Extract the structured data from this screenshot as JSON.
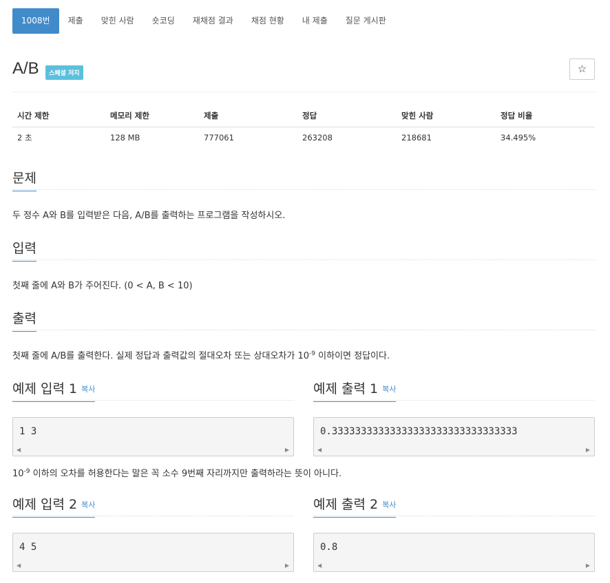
{
  "tabs": [
    {
      "label": "1008번",
      "active": true
    },
    {
      "label": "제출"
    },
    {
      "label": "맞힌 사람"
    },
    {
      "label": "숏코딩"
    },
    {
      "label": "재채점 결과"
    },
    {
      "label": "채점 현황"
    },
    {
      "label": "내 제출"
    },
    {
      "label": "질문 게시판"
    }
  ],
  "problem": {
    "title": "A/B",
    "badge": "스페셜 저지",
    "star_icon": "☆"
  },
  "info": {
    "headers": [
      "시간 제한",
      "메모리 제한",
      "제출",
      "정답",
      "맞힌 사람",
      "정답 비율"
    ],
    "values": [
      "2 초",
      "128 MB",
      "777061",
      "263208",
      "218681",
      "34.495%"
    ]
  },
  "sections": {
    "problem_title": "문제",
    "problem_text": "두 정수 A와 B를 입력받은 다음, A/B를 출력하는 프로그램을 작성하시오.",
    "input_title": "입력",
    "input_text": "첫째 줄에 A와 B가 주어진다. (0 < A, B < 10)",
    "output_title": "출력",
    "output_text_1": "첫째 줄에 A/B를 출력한다. 실제 정답과 출력값의 절대오차 또는 상대오차가 10",
    "output_exp": "-9",
    "output_text_2": " 이하이면 정답이다."
  },
  "samples": {
    "copy_label": "복사",
    "input1_title": "예제 입력 1",
    "input1_value": "1 3",
    "output1_title": "예제 출력 1",
    "output1_value": "0.33333333333333333333333333333333",
    "note_base": "10",
    "note_exp": "-9",
    "note_text": " 이하의 오차를 허용한다는 말은 꼭 소수 9번째 자리까지만 출력하라는 뜻이 아니다.",
    "input2_title": "예제 입력 2",
    "input2_value": "4 5",
    "output2_title": "예제 출력 2",
    "output2_value": "0.8"
  }
}
